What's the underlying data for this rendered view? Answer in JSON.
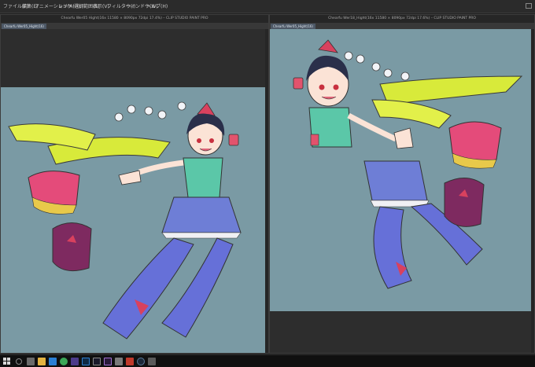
{
  "menubar": {
    "items": [
      "ファイル(F)",
      "編集(E)",
      "アニメーション(A)",
      "レイヤー(L)",
      "選択範囲(S)",
      "表示(V)",
      "フィルター(I)",
      "ウィンドウ(W)",
      "ヘルプ(H)"
    ]
  },
  "left_document": {
    "title": "Chearfu Wer05 Hight(16x 11580 × 8090px 72dpi 17.4%) – CLIP STUDIO PAINT PRO",
    "tab_label": "Chearfu Wer05_Hight(16)"
  },
  "right_document": {
    "title": "Chearfu Wer18_Hight(16x 11580 × 8090px 72dpi 17.6%) – CLIP STUDIO PAINT PRO",
    "tab_label": "Chearfu Wer05_Hight(16)"
  },
  "colors": {
    "canvas_background": "#7a9aa4",
    "app_background": "#2d2d2d",
    "menubar_background": "#2b2b2b",
    "taskbar_background": "#101010"
  },
  "taskbar": {
    "icons": [
      "windows-start-icon",
      "search-icon",
      "task-view-icon",
      "explorer-icon",
      "edge-icon",
      "chrome-icon",
      "clip-studio-icon",
      "photoshop-icon",
      "clip-studio-paint-icon",
      "premiere-icon",
      "settings-icon",
      "media-icon",
      "steam-icon",
      "misc-icon"
    ]
  }
}
